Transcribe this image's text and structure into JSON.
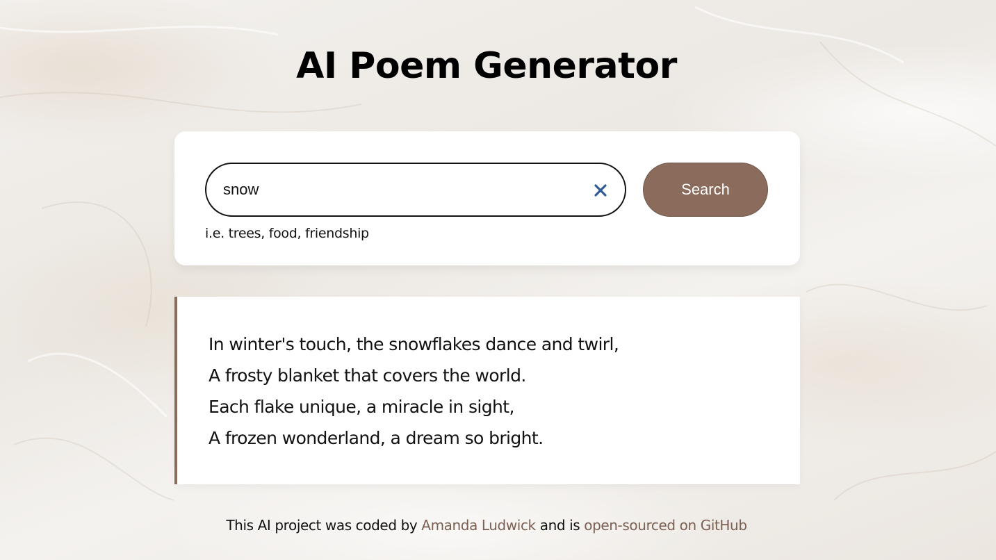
{
  "header": {
    "title": "AI Poem Generator"
  },
  "search": {
    "value": "snow",
    "placeholder": "",
    "hint": "i.e. trees, food, friendship",
    "button_label": "Search",
    "clear_icon": "close-icon"
  },
  "poem": {
    "lines": [
      "In winter's touch, the snowflakes dance and twirl,",
      "A frosty blanket that covers the world.",
      "Each flake unique, a miracle in sight,",
      "A frozen wonderland, a dream so bright."
    ]
  },
  "footer": {
    "prefix": "This AI project was coded by",
    "author_link": "Amanda Ludwick",
    "middle": "and is",
    "repo_link": "open-sourced on GitHub"
  },
  "colors": {
    "accent": "#8b6b5c",
    "link": "#7a5f52",
    "card": "#ffffff",
    "background": "#f1efec",
    "clear_icon": "#2f5b9a"
  }
}
